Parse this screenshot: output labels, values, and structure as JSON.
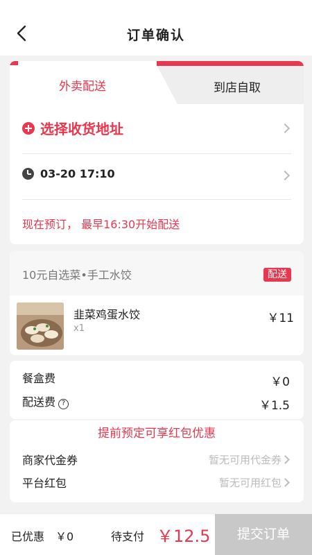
{
  "header": {
    "title": "订单确认",
    "back_icon": "chevron-left-icon"
  },
  "delivery": {
    "tabs": [
      {
        "label": "外卖配送",
        "active": true
      },
      {
        "label": "到店自取",
        "active": false
      }
    ],
    "address_label": "选择收货地址",
    "time_label": "03-20 17:10",
    "notice": "现在预订， 最早16:30开始配送"
  },
  "order": {
    "shop_name": "10元自选菜•手工水饺",
    "badge": "配送",
    "items": [
      {
        "name": "韭菜鸡蛋水饺",
        "qty": "x1",
        "price": "￥11"
      }
    ]
  },
  "fees": {
    "box_fee_label": "餐盒费",
    "box_fee_value": "￥0",
    "delivery_fee_label": "配送费",
    "delivery_fee_value": "￥1.5"
  },
  "promo": {
    "title": "提前预定可享红包优惠",
    "voucher_label": "商家代金券",
    "voucher_value": "暂无可用代金券",
    "redpacket_label": "平台红包",
    "redpacket_value": "暂无可用红包"
  },
  "footer": {
    "saved_label": "已优惠",
    "saved_value": "￥0",
    "pay_label": "待支付",
    "pay_value": "￥12.5",
    "submit_label": "提交订单"
  },
  "colors": {
    "accent": "#e8374e",
    "disabled": "#c8c8c8"
  }
}
